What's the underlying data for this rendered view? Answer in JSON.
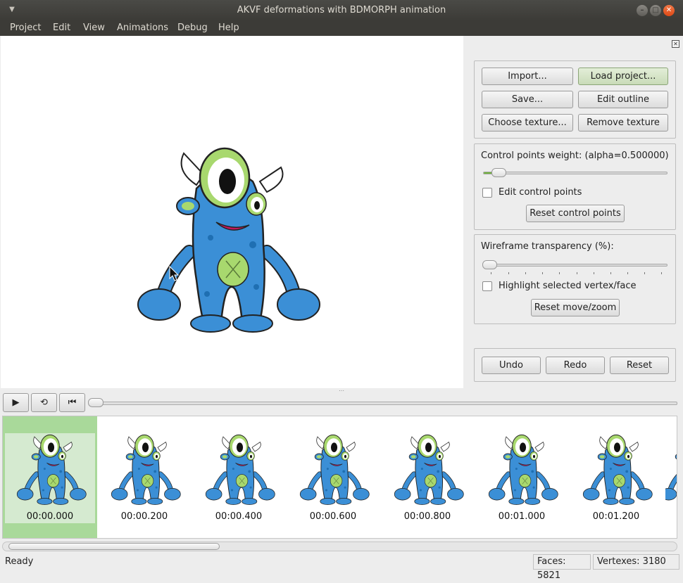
{
  "window": {
    "title": "AKVF deformations with BDMORPH animation",
    "menu_icon": "chevron-down-icon"
  },
  "menubar": {
    "items": [
      "Project",
      "Edit",
      "View",
      "Animations",
      "Debug",
      "Help"
    ]
  },
  "project_group": {
    "import": "Import...",
    "load_project": "Load project...",
    "save": "Save...",
    "edit_outline": "Edit outline",
    "choose_texture": "Choose texture...",
    "remove_texture": "Remove texture"
  },
  "control_group": {
    "weight_label": "Control points weight: (alpha=0.500000)",
    "weight_value": 0.5,
    "edit_cp_label": "Edit control points",
    "edit_cp_checked": false,
    "reset_cp": "Reset control points"
  },
  "wire_group": {
    "transparency_label": "Wireframe transparency (%):",
    "transparency_value": 0,
    "highlight_label": "Highlight selected vertex/face",
    "highlight_checked": false,
    "reset_move": "Reset move/zoom"
  },
  "history_group": {
    "undo": "Undo",
    "redo": "Redo",
    "reset": "Reset"
  },
  "timeline": {
    "play_icon": "play-icon",
    "loop_icon": "loop-icon",
    "rewind_icon": "skip-to-start-icon",
    "position": 0
  },
  "frames": [
    {
      "label": "00:00.000",
      "selected": true
    },
    {
      "label": "00:00.200",
      "selected": false
    },
    {
      "label": "00:00.400",
      "selected": false
    },
    {
      "label": "00:00.600",
      "selected": false
    },
    {
      "label": "00:00.800",
      "selected": false
    },
    {
      "label": "00:01.000",
      "selected": false
    },
    {
      "label": "00:01.200",
      "selected": false
    }
  ],
  "status": {
    "text": "Ready",
    "faces": "Faces: 5821",
    "vertexes": "Vertexes: 3180"
  },
  "colors": {
    "monster_body": "#3b8fd6",
    "monster_eye": "#a8d86e",
    "titlebar": "#3c3b37",
    "close": "#e9541d",
    "selection": "#a9d99a"
  }
}
